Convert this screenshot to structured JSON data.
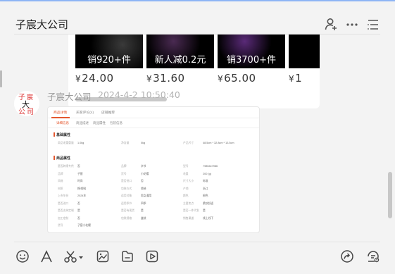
{
  "window": {
    "title": "子宸大公司"
  },
  "header_icons": [
    "add-contact-icon",
    "more-icon",
    "list-icon"
  ],
  "product_strip": {
    "items": [
      {
        "tag": "销920+件",
        "price": "24.00",
        "currency": "¥"
      },
      {
        "tag": "新人减0.2元",
        "price": "31.60",
        "currency": "¥"
      },
      {
        "tag": "销3700+件",
        "price": "65.00",
        "currency": "¥"
      },
      {
        "tag": "",
        "price": "1",
        "currency": "¥"
      }
    ]
  },
  "message": {
    "sender": "子宸大公司",
    "time": "2024-4-2 10:50:40",
    "avatar_text": [
      "子",
      "宸",
      "大",
      "公",
      "司"
    ]
  },
  "screenshot": {
    "tabs": [
      "商品详情",
      "买家评论(4)",
      "店铺推荐"
    ],
    "sub_tabs": [
      "详细信息",
      "商品描述",
      "商品属性",
      "包装信息"
    ],
    "section_basic": "基础属性",
    "basic_fields": [
      [
        "商品毛重重量",
        "1.0kg"
      ],
      [
        "净含量",
        "0kg"
      ],
      [
        "产品尺寸",
        "48.5cm * 32.8cm * 13.5cm"
      ]
    ],
    "section_goods": "商品属性",
    "goods_fields": [
      [
        "是否跨境专供",
        "否"
      ],
      [
        "品牌",
        "字节"
      ],
      [
        "型号",
        "7985447986"
      ],
      [
        "品牌",
        "子宸"
      ],
      [
        "货号",
        "小花樱"
      ],
      [
        "毛重",
        "200 (g)"
      ],
      [
        "风格",
        "时尚"
      ],
      [
        "是否进口",
        "否"
      ],
      [
        "尺寸大小",
        "标准"
      ],
      [
        "材质",
        "棉/塑料"
      ],
      [
        "包装方式",
        "袋装"
      ],
      [
        "产地",
        "浙江"
      ],
      [
        "上市年份",
        "2024年"
      ],
      [
        "适用对象",
        "男女通用"
      ],
      [
        "颜色",
        "粉色"
      ],
      [
        "是否进口",
        "否"
      ],
      [
        "适用季节",
        "四季"
      ],
      [
        "主要卖点",
        "柔软舒适"
      ],
      [
        "是否支持定制",
        "是"
      ],
      [
        "是否有现货",
        "是"
      ],
      [
        "是否一件代发",
        "是"
      ],
      [
        "加工定制",
        "否"
      ],
      [
        "包装规格",
        "盒装"
      ],
      [
        "销售渠道",
        "线上线下"
      ],
      [
        "货号",
        "子宸小花樱"
      ]
    ]
  },
  "toolbar": [
    "emoji-icon",
    "font-icon",
    "scissors-icon",
    "image-icon",
    "file-icon",
    "video-icon",
    "share-icon",
    "history-icon"
  ]
}
